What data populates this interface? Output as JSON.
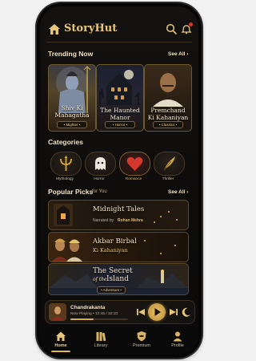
{
  "app": {
    "name": "StoryHut"
  },
  "trending": {
    "title": "Trending Now",
    "see_all": "See All ›",
    "cards": [
      {
        "line1": "Shiv Ki",
        "line2": "Mahagatha",
        "tag": "• Mighter •"
      },
      {
        "line1": "The Haunted",
        "line2": "Manor",
        "tag": "• Horror •"
      },
      {
        "line1": "Premchand",
        "line2": "Ki Kahaniyan",
        "tag": "• Classics •"
      }
    ]
  },
  "categories": {
    "title": "Categories",
    "items": [
      {
        "label": "Mythology",
        "icon": "trident-icon"
      },
      {
        "label": "Horror",
        "icon": "ghost-icon"
      },
      {
        "label": "Romance",
        "icon": "heart-icon"
      },
      {
        "label": "Thriller",
        "icon": "quill-icon"
      }
    ]
  },
  "popular": {
    "title": "Popular Picks",
    "subtitle": "for You",
    "see_all": "See All ›",
    "items": [
      {
        "title": "Midnight Tales",
        "sub_prefix": "Narrated by",
        "sub_name": "Rohan Mehra"
      },
      {
        "title": "Akbar Birbal",
        "sub": "Ki Kahaniyan"
      },
      {
        "title_line1": "The Secret",
        "title_line2_a": "of the",
        "title_line2_b": "Island",
        "tag": "• Adventure •"
      }
    ]
  },
  "player": {
    "title": "Chandrakanta",
    "status": "Now Playing • 12:45 / 32:10",
    "progress": 0.4
  },
  "nav": [
    {
      "label": "Home",
      "icon": "home-icon",
      "active": true
    },
    {
      "label": "Library",
      "icon": "library-icon",
      "active": false
    },
    {
      "label": "Premium",
      "icon": "crown-shield-icon",
      "active": false
    },
    {
      "label": "Profile",
      "icon": "profile-icon",
      "active": false
    }
  ],
  "colors": {
    "accent": "#e1b75c",
    "background": "#0d0c0b",
    "text": "#f1e3c3",
    "notification": "#d8352a"
  }
}
